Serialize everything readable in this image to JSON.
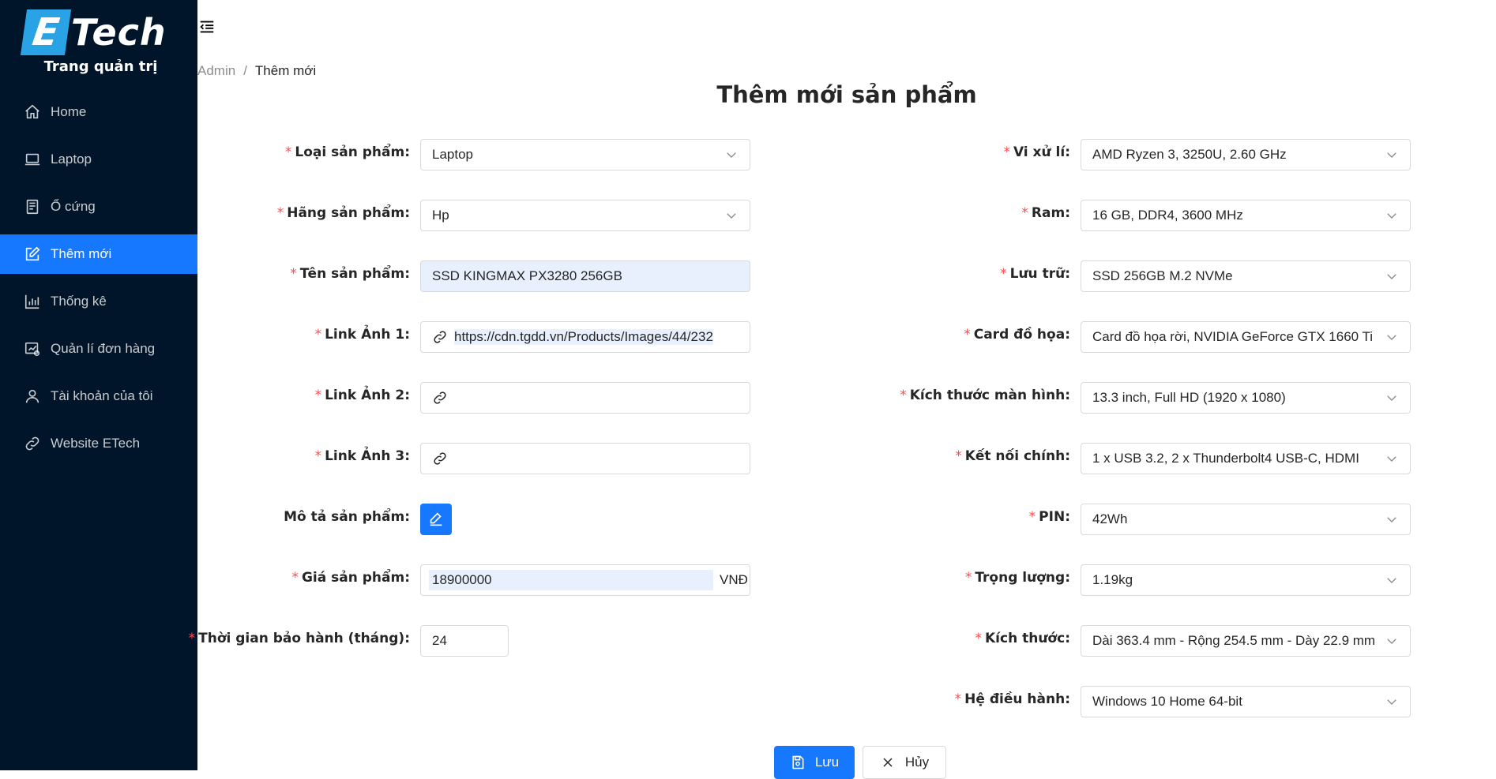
{
  "brand": {
    "logo_letter": "E",
    "logo_text": "Tech",
    "subtitle": "Trang quản trị"
  },
  "sidebar": {
    "items": [
      {
        "label": "Home",
        "icon": "home-icon"
      },
      {
        "label": "Laptop",
        "icon": "laptop-icon"
      },
      {
        "label": "Ổ cứng",
        "icon": "drive-icon"
      },
      {
        "label": "Thêm mới",
        "icon": "edit-icon",
        "active": true
      },
      {
        "label": "Thống kê",
        "icon": "chart-icon"
      },
      {
        "label": "Quản lí đơn hàng",
        "icon": "orders-icon"
      },
      {
        "label": "Tài khoản của tôi",
        "icon": "user-icon"
      },
      {
        "label": "Website ETech",
        "icon": "link-icon"
      }
    ]
  },
  "breadcrumb": {
    "root": "Admin",
    "separator": "/",
    "current": "Thêm mới"
  },
  "page_title": "Thêm mới sản phẩm",
  "left_form": {
    "product_type": {
      "label": "Loại sản phẩm",
      "value": "Laptop"
    },
    "brand": {
      "label": "Hãng sản phẩm",
      "value": "Hp"
    },
    "name": {
      "label": "Tên sản phẩm",
      "value": "SSD KINGMAX PX3280 256GB"
    },
    "image1": {
      "label": "Link Ảnh 1",
      "value": "https://cdn.tgdd.vn/Products/Images/44/232"
    },
    "image2": {
      "label": "Link Ảnh 2",
      "value": ""
    },
    "image3": {
      "label": "Link Ảnh 3",
      "value": ""
    },
    "description": {
      "label": "Mô tả sản phẩm"
    },
    "price": {
      "label": "Giá sản phẩm",
      "value": "18900000",
      "suffix": "VNĐ"
    },
    "warranty": {
      "label": "Thời gian bảo hành (tháng)",
      "value": "24"
    }
  },
  "right_form": {
    "cpu": {
      "label": "Vi xử lí",
      "value": "AMD Ryzen 3, 3250U, 2.60 GHz"
    },
    "ram": {
      "label": "Ram",
      "value": "16 GB, DDR4, 3600 MHz"
    },
    "storage": {
      "label": "Lưu trữ",
      "value": "SSD 256GB M.2 NVMe"
    },
    "gpu": {
      "label": "Card đồ họa",
      "value": "Card đồ họa rời, NVIDIA GeForce GTX 1660 Ti"
    },
    "screen": {
      "label": "Kích thước màn hình",
      "value": "13.3 inch, Full HD (1920 x 1080)"
    },
    "ports": {
      "label": "Kết nối chính",
      "value": "1 x USB 3.2, 2 x Thunderbolt4 USB-C, HDMI"
    },
    "battery": {
      "label": "PIN",
      "value": "42Wh"
    },
    "weight": {
      "label": "Trọng lượng",
      "value": "1.19kg"
    },
    "dimensions": {
      "label": "Kích thước",
      "value": "Dài 363.4 mm - Rộng 254.5 mm - Dày 22.9 mm"
    },
    "os": {
      "label": "Hệ điều hành",
      "value": "Windows 10 Home 64-bit"
    }
  },
  "actions": {
    "save": "Lưu",
    "cancel": "Hủy"
  },
  "colors": {
    "sidebar_bg": "#001529",
    "accent": "#1677ff",
    "required": "#ff4d4f",
    "autofill": "#e8f0fe"
  }
}
